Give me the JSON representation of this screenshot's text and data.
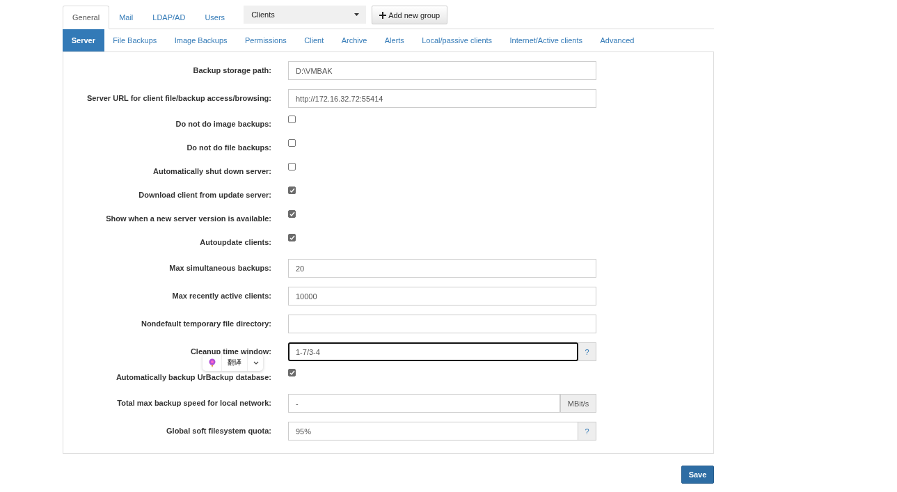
{
  "top_tabs": [
    {
      "label": "General",
      "selected": true
    },
    {
      "label": "Mail",
      "selected": false
    },
    {
      "label": "LDAP/AD",
      "selected": false
    },
    {
      "label": "Users",
      "selected": false
    }
  ],
  "group_select": {
    "value": "Clients"
  },
  "add_group_button": {
    "label": "Add new group"
  },
  "sub_tabs": [
    {
      "label": "Server",
      "selected": true
    },
    {
      "label": "File Backups",
      "selected": false
    },
    {
      "label": "Image Backups",
      "selected": false
    },
    {
      "label": "Permissions",
      "selected": false
    },
    {
      "label": "Client",
      "selected": false
    },
    {
      "label": "Archive",
      "selected": false
    },
    {
      "label": "Alerts",
      "selected": false
    },
    {
      "label": "Local/passive clients",
      "selected": false
    },
    {
      "label": "Internet/Active clients",
      "selected": false
    },
    {
      "label": "Advanced",
      "selected": false
    }
  ],
  "settings": [
    {
      "kind": "text",
      "label": "Backup storage path:",
      "value": "D:\\VMBAK"
    },
    {
      "kind": "text",
      "label": "Server URL for client file/backup access/browsing:",
      "value": "http://172.16.32.72:55414"
    },
    {
      "kind": "checkbox",
      "label": "Do not do image backups:",
      "checked": false
    },
    {
      "kind": "checkbox",
      "label": "Do not do file backups:",
      "checked": false
    },
    {
      "kind": "checkbox",
      "label": "Automatically shut down server:",
      "checked": false
    },
    {
      "kind": "checkbox",
      "label": "Download client from update server:",
      "checked": true
    },
    {
      "kind": "checkbox",
      "label": "Show when a new server version is available:",
      "checked": true
    },
    {
      "kind": "checkbox",
      "label": "Autoupdate clients:",
      "checked": true
    },
    {
      "kind": "text",
      "label": "Max simultaneous backups:",
      "value": "20"
    },
    {
      "kind": "text",
      "label": "Max recently active clients:",
      "value": "10000"
    },
    {
      "kind": "text",
      "label": "Nondefault temporary file directory:"
    },
    {
      "kind": "text",
      "label": "Cleanup time window:",
      "value": "1-7/3-4",
      "addon": "?",
      "focused": true
    },
    {
      "kind": "checkbox",
      "label": "Automatically backup UrBackup database:",
      "checked": true
    },
    {
      "kind": "text",
      "label": "Total max backup speed for local network:",
      "value": "-",
      "addon": "MBit/s"
    },
    {
      "kind": "text",
      "label": "Global soft filesystem quota:",
      "value": "95%",
      "addon": "?"
    }
  ],
  "translate_popup": {
    "label": "翻译"
  },
  "save_button": {
    "label": "Save"
  }
}
